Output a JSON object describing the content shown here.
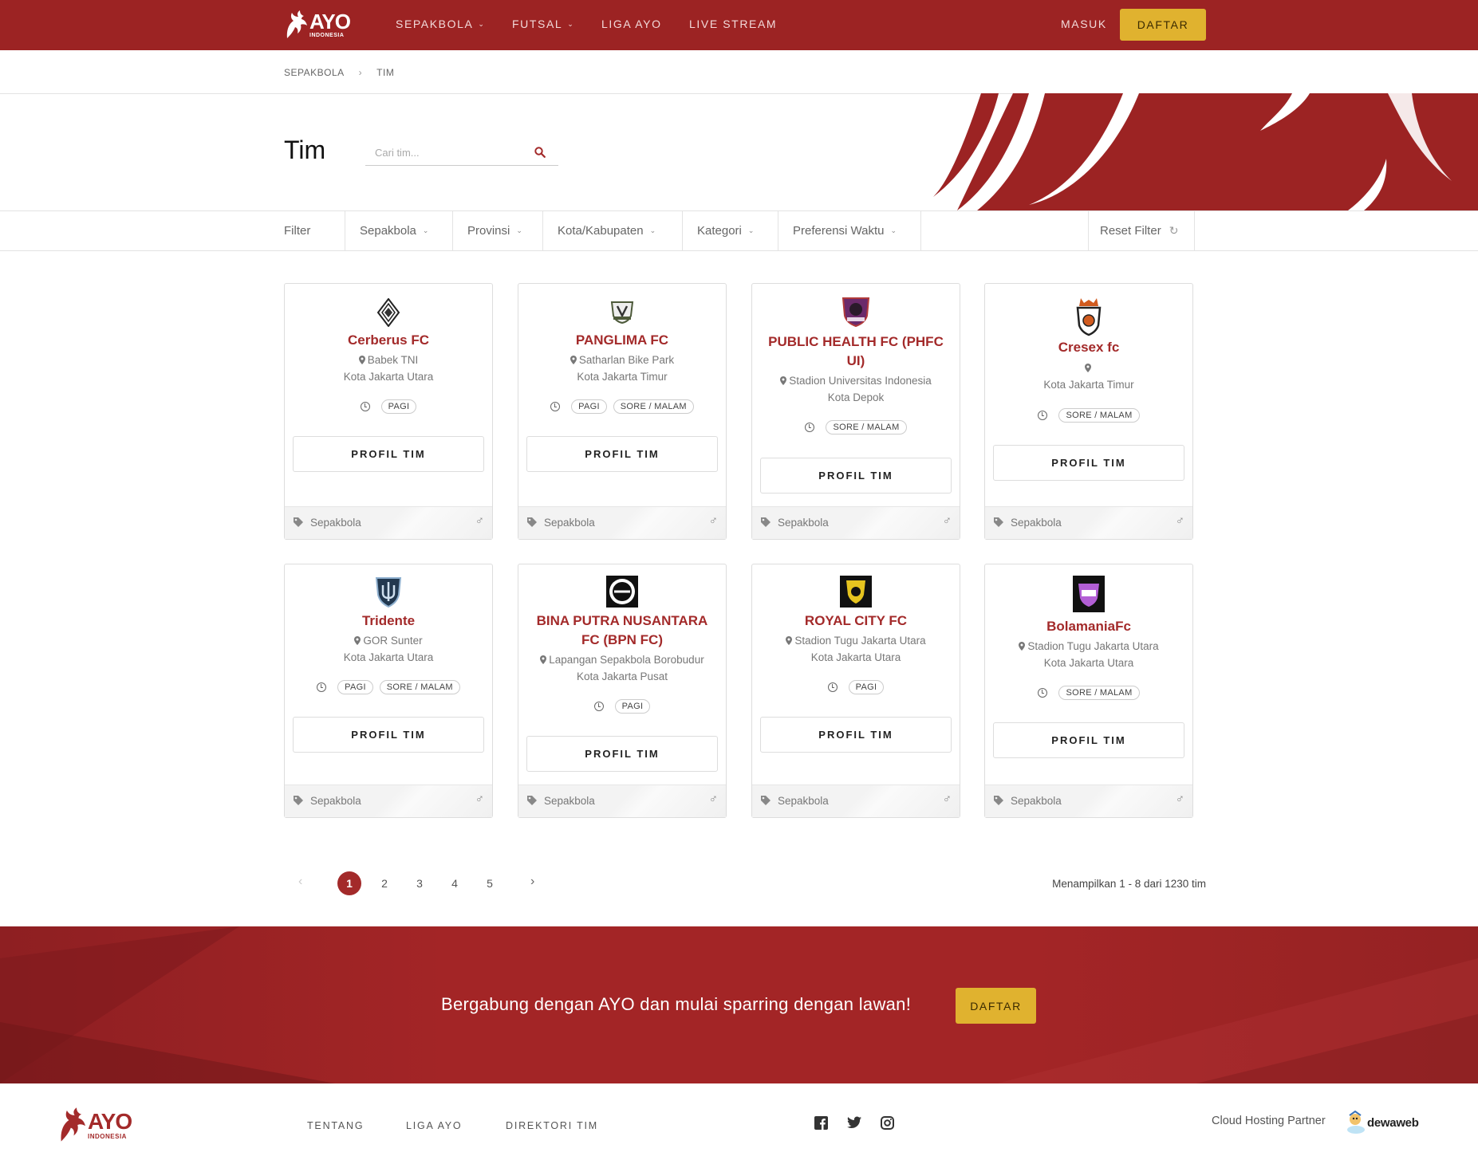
{
  "brand": {
    "name": "AYO",
    "sub": "INDONESIA"
  },
  "nav": {
    "items": [
      {
        "label": "SEPAKBOLA",
        "dropdown": true
      },
      {
        "label": "FUTSAL",
        "dropdown": true
      },
      {
        "label": "LIGA AYO",
        "dropdown": false
      },
      {
        "label": "LIVE STREAM",
        "dropdown": false
      }
    ],
    "login": "MASUK",
    "register": "DAFTAR"
  },
  "breadcrumb": [
    "SEPAKBOLA",
    "TIM"
  ],
  "page": {
    "title": "Tim",
    "search_placeholder": "Cari tim..."
  },
  "filters": {
    "label": "Filter",
    "items": [
      "Sepakbola",
      "Provinsi",
      "Kota/Kabupaten",
      "Kategori",
      "Preferensi Waktu"
    ],
    "reset": "Reset Filter"
  },
  "teams": [
    {
      "name": "Cerberus FC",
      "venue": "Babek TNI",
      "city": "Kota Jakarta Utara",
      "times": [
        "PAGI"
      ],
      "sport": "Sepakbola",
      "button": "PROFIL TIM"
    },
    {
      "name": "PANGLIMA FC",
      "venue": "Satharlan Bike Park",
      "city": "Kota Jakarta Timur",
      "times": [
        "PAGI",
        "SORE / MALAM"
      ],
      "sport": "Sepakbola",
      "button": "PROFIL TIM"
    },
    {
      "name": "PUBLIC HEALTH FC (PHFC UI)",
      "venue": "Stadion Universitas Indonesia",
      "city": "Kota Depok",
      "times": [
        "SORE / MALAM"
      ],
      "sport": "Sepakbola",
      "button": "PROFIL TIM"
    },
    {
      "name": "Cresex fc",
      "venue": "",
      "city": "Kota Jakarta Timur",
      "times": [
        "SORE / MALAM"
      ],
      "sport": "Sepakbola",
      "button": "PROFIL TIM"
    },
    {
      "name": "Tridente",
      "venue": "GOR Sunter",
      "city": "Kota Jakarta Utara",
      "times": [
        "PAGI",
        "SORE / MALAM"
      ],
      "sport": "Sepakbola",
      "button": "PROFIL TIM"
    },
    {
      "name": "BINA PUTRA NUSANTARA FC (BPN FC)",
      "venue": "Lapangan Sepakbola Borobudur",
      "city": "Kota Jakarta Pusat",
      "times": [
        "PAGI"
      ],
      "sport": "Sepakbola",
      "button": "PROFIL TIM"
    },
    {
      "name": "ROYAL CITY FC",
      "venue": "Stadion Tugu Jakarta Utara",
      "city": "Kota Jakarta Utara",
      "times": [
        "PAGI"
      ],
      "sport": "Sepakbola",
      "button": "PROFIL TIM"
    },
    {
      "name": "BolamaniaFc",
      "venue": "Stadion Tugu Jakarta Utara",
      "city": "Kota Jakarta Utara",
      "times": [
        "SORE / MALAM"
      ],
      "sport": "Sepakbola",
      "button": "PROFIL TIM"
    }
  ],
  "pagination": {
    "pages": [
      "1",
      "2",
      "3",
      "4",
      "5"
    ],
    "current": "1",
    "summary": "Menampilkan 1 - 8 dari 1230 tim"
  },
  "cta": {
    "text": "Bergabung dengan AYO dan mulai sparring dengan lawan!",
    "button": "DAFTAR"
  },
  "footer": {
    "links": [
      "TENTANG",
      "LIGA AYO",
      "DIREKTORI TIM"
    ],
    "social": [
      "facebook-icon",
      "twitter-icon",
      "instagram-icon"
    ],
    "partner_label": "Cloud Hosting Partner",
    "partner_name": "dewaweb"
  },
  "colors": {
    "brand_red": "#9c2323",
    "accent_yellow": "#e0b22f",
    "team_name": "#a32a2a"
  }
}
